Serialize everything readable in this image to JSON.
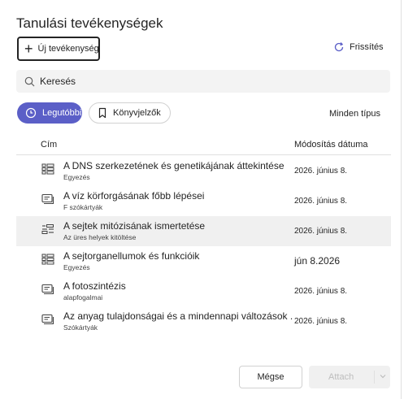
{
  "header": {
    "title": "Tanulási tevékenységek",
    "new_activity_label": "Új tevékenység",
    "refresh_label": "Frissítés"
  },
  "search": {
    "placeholder": "Keresés"
  },
  "filters": {
    "recent_label": "Legutóbbi",
    "bookmarks_label": "Könyvjelzők",
    "all_types_label": "Minden típus"
  },
  "table": {
    "columns": {
      "title": "Cím",
      "modified": "Módosítás dátuma"
    },
    "rows": [
      {
        "title": "A DNS szerkezetének és genetikájának áttekintése",
        "subtitle": "Egyezés",
        "date": "2026. június 8.",
        "icon": "match-grid-icon"
      },
      {
        "title": "A víz körforgásának főbb lépései",
        "subtitle": "F szókártyák",
        "date": "2026. június 8.",
        "icon": "flashcards-icon"
      },
      {
        "title": "A sejtek mitózisának ismertetése",
        "subtitle": "Az üres helyek kitöltése",
        "date": "2026. június 8.",
        "icon": "fill-blanks-icon"
      },
      {
        "title": "A sejtorganellumok és funkcióik",
        "subtitle": "Egyezés",
        "date": "jún 8.2026",
        "icon": "match-grid-icon"
      },
      {
        "title": "A fotoszintézis",
        "subtitle": "alapfogalmai",
        "date": "2026. június 8.",
        "icon": "flashcards-icon"
      },
      {
        "title": "Az anyag tulajdonságai és a mindennapi változások .",
        "subtitle": "Szókártyák",
        "date": "2026. június 8.",
        "icon": "flashcards-icon"
      }
    ],
    "selected_row": 2
  },
  "footer": {
    "cancel_label": "Mégse",
    "attach_label": "Attach"
  },
  "colors": {
    "accent": "#5b5fc7",
    "selected_row_bg": "#f0f0f0",
    "search_bg": "#f3f3f3"
  }
}
